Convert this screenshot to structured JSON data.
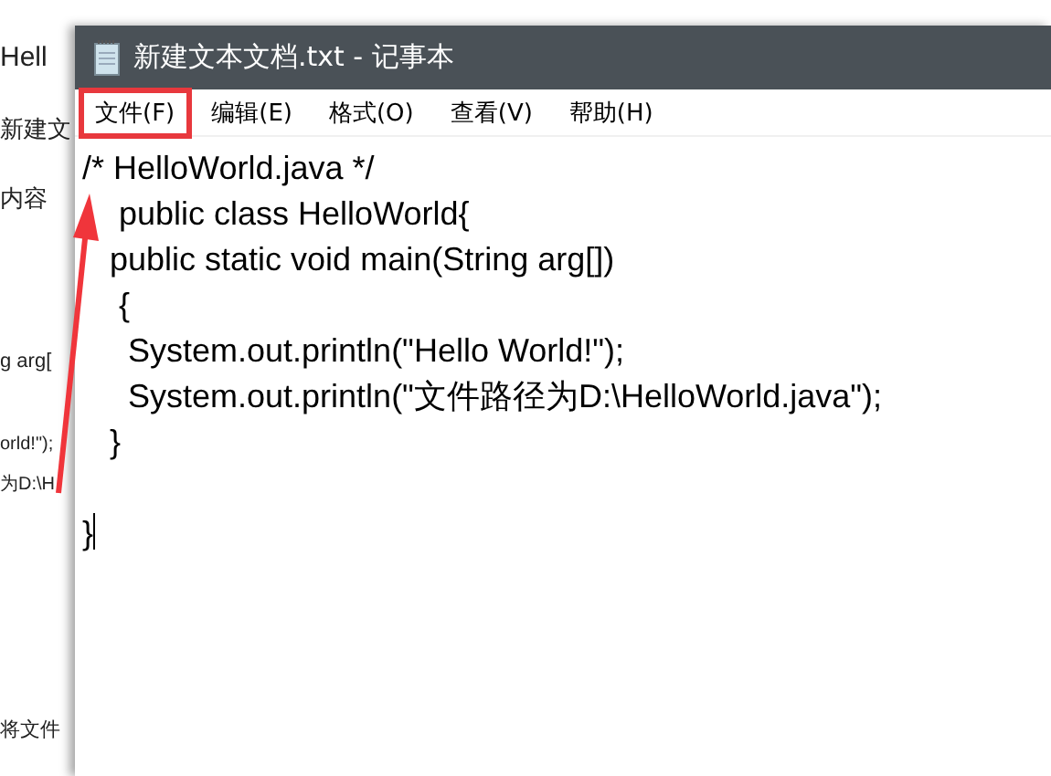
{
  "background_document": {
    "lines": [
      "Hell",
      "新建文",
      "内容",
      "g arg[",
      "orld!\");",
      "为D:\\H",
      "将文件"
    ]
  },
  "window": {
    "title": "新建文本文档.txt - 记事本",
    "menu": [
      {
        "label": "文件(F)",
        "highlighted": true
      },
      {
        "label": "编辑(E)",
        "highlighted": false
      },
      {
        "label": "格式(O)",
        "highlighted": false
      },
      {
        "label": "查看(V)",
        "highlighted": false
      },
      {
        "label": "帮助(H)",
        "highlighted": false
      }
    ],
    "content": "/* HelloWorld.java */\n    public class HelloWorld{\n   public static void main(String arg[])\n    {\n     System.out.println(\"Hello World!\");\n     System.out.println(\"文件路径为D:\\HelloWorld.java\");\n   }\n\n}"
  }
}
